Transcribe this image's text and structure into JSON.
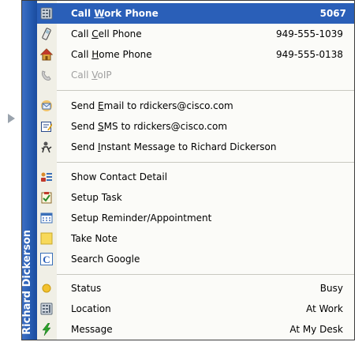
{
  "contact": {
    "name": "Richard Dickerson"
  },
  "colors": {
    "highlight": "#2a5fb8",
    "strip": "#245ab0"
  },
  "call_items": [
    {
      "label_pre": "Call ",
      "accel": "W",
      "label_post": "ork Phone",
      "value": "5067",
      "icon": "desk-phone-icon"
    },
    {
      "label_pre": "Call ",
      "accel": "C",
      "label_post": "ell Phone",
      "value": "949-555-1039",
      "icon": "cell-phone-icon"
    },
    {
      "label_pre": "Call ",
      "accel": "H",
      "label_post": "ome Phone",
      "value": "949-555-0138",
      "icon": "home-icon"
    },
    {
      "label_pre": "Call ",
      "accel": "V",
      "label_post": "oIP",
      "value": "",
      "icon": "voip-handset-icon"
    }
  ],
  "message_items": [
    {
      "label_pre": "Send ",
      "accel": "E",
      "label_post": "mail to rdickers@cisco.com",
      "icon": "email-icon"
    },
    {
      "label_pre": "Send ",
      "accel": "S",
      "label_post": "MS to rdickers@cisco.com",
      "icon": "sms-icon"
    },
    {
      "label_pre": "Send ",
      "accel": "I",
      "label_post": "nstant Message to Richard Dickerson",
      "icon": "instant-message-icon"
    }
  ],
  "action_items": [
    {
      "label": "Show Contact Detail",
      "icon": "contact-card-icon"
    },
    {
      "label": "Setup Task",
      "icon": "task-icon"
    },
    {
      "label": "Setup Reminder/Appointment",
      "icon": "calendar-icon"
    },
    {
      "label": "Take Note",
      "icon": "note-icon"
    },
    {
      "label": "Search Google",
      "icon": "google-icon"
    }
  ],
  "status_items": [
    {
      "label": "Status",
      "value": "Busy",
      "icon": "status-dot-icon"
    },
    {
      "label": "Location",
      "value": "At Work",
      "icon": "building-icon"
    },
    {
      "label": "Message",
      "value": "At My Desk",
      "icon": "lightning-icon"
    }
  ]
}
